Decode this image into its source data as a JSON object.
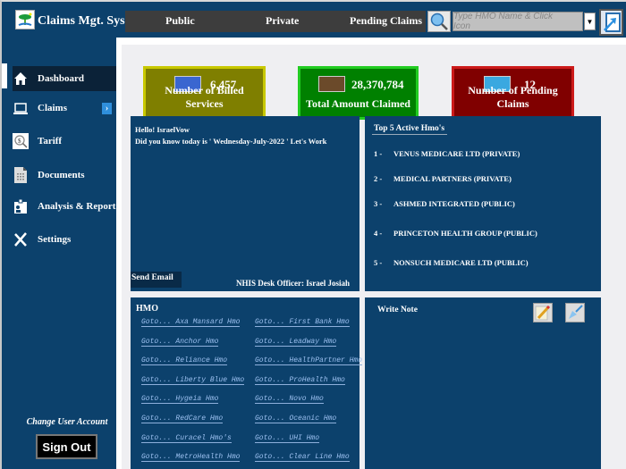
{
  "app": {
    "title": "Claims Mgt. Sys."
  },
  "nav": {
    "items": [
      "Public",
      "Private",
      "Pending Claims"
    ]
  },
  "search": {
    "placeholder": "Type HMO Name & Click Icon",
    "value": ""
  },
  "sidebar": {
    "items": [
      {
        "label": "Dashboard",
        "icon": "home-icon",
        "active": true
      },
      {
        "label": "Claims",
        "icon": "laptop-icon",
        "has_submenu": true
      },
      {
        "label": "Tariff",
        "icon": "magnifier-icon"
      },
      {
        "label": "Documents",
        "icon": "document-icon"
      },
      {
        "label": "Analysis & Report",
        "icon": "badge-icon"
      },
      {
        "label": "Settings",
        "icon": "tools-icon"
      }
    ],
    "change_user": "Change User Account",
    "sign_out": "Sign Out"
  },
  "stats": [
    {
      "value": "6,457",
      "label": "Number of Billed Services",
      "bg": "#7f7f00",
      "border": "#c8c800"
    },
    {
      "value": "28,370,784",
      "label": "Total Amount Claimed",
      "bg": "#008000",
      "border": "#22cc22"
    },
    {
      "value": "12",
      "label": "Number of Pending Claims",
      "bg": "#800000",
      "border": "#cc1a1a"
    }
  ],
  "greeting": {
    "hello": "Hello! IsraelVow",
    "message": "Did you know today is  ' Wednesday-July-2022 '  Let's Work",
    "send_email": "Send Email",
    "officer": "NHIS Desk Officer: Israel Josiah"
  },
  "top5": {
    "title": "Top 5 Active Hmo's",
    "items": [
      {
        "index": "1 -",
        "name": "VENUS MEDICARE LTD (PRIVATE)"
      },
      {
        "index": "2 -",
        "name": "MEDICAL PARTNERS (PRIVATE)"
      },
      {
        "index": "3 -",
        "name": "ASHMED INTEGRATED (PUBLIC)"
      },
      {
        "index": "4 -",
        "name": "PRINCETON HEALTH GROUP (PUBLIC)"
      },
      {
        "index": "5 -",
        "name": "NONSUCH MEDICARE LTD (PUBLIC)"
      }
    ]
  },
  "hmo": {
    "title": "HMO",
    "left": [
      "Goto... Axa Mansard Hmo",
      "Goto... Anchor Hmo",
      "Goto... Reliance Hmo",
      "Goto... Liberty Blue Hmo",
      "Goto... Hygeia Hmo",
      "Goto... RedCare Hmo",
      "Goto... Curacel Hmo's",
      "Goto... MetroHealth Hmo"
    ],
    "right": [
      "Goto... First Bank Hmo",
      "Goto... Leadway Hmo",
      "Goto... HealthPartner Hmo",
      "Goto... ProHealth Hmo",
      "Goto... Novo Hmo",
      "Goto... Oceanic Hmo",
      "Goto... UHI Hmo",
      "Goto... Clear Line Hmo"
    ]
  },
  "note": {
    "title": "Write Note"
  }
}
